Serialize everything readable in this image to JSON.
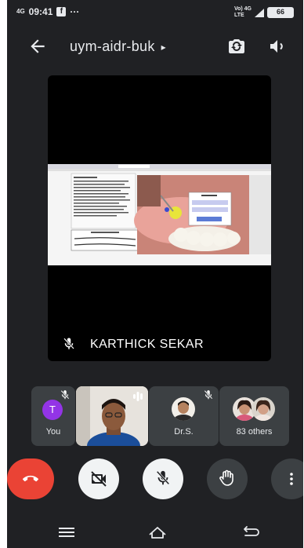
{
  "status_bar": {
    "network_left": "4G",
    "time": "09:41",
    "app_badge": "f",
    "more": "···",
    "network_right": "Vo) 4G\nLTE",
    "battery": "66"
  },
  "header": {
    "meeting_code": "uym-aidr-buk",
    "caret": "▸"
  },
  "stage": {
    "presenter_name": "KARTHICK SEKAR"
  },
  "participants": [
    {
      "label": "You",
      "initial": "T"
    },
    {
      "label": ""
    },
    {
      "label": "Dr.S."
    },
    {
      "label": "83 others"
    }
  ],
  "colors": {
    "background": "#202124",
    "tile": "#3c4043",
    "end_call": "#ea4335",
    "avatar": "#9334e6"
  },
  "icons": {
    "back": "arrow-left-icon",
    "switch_camera": "switch-camera-icon",
    "speaker": "speaker-icon",
    "mic_off": "mic-off-icon",
    "end_call": "phone-hangup-icon",
    "camera_off": "camera-off-icon",
    "raise_hand": "hand-icon",
    "more": "more-vert-icon"
  }
}
